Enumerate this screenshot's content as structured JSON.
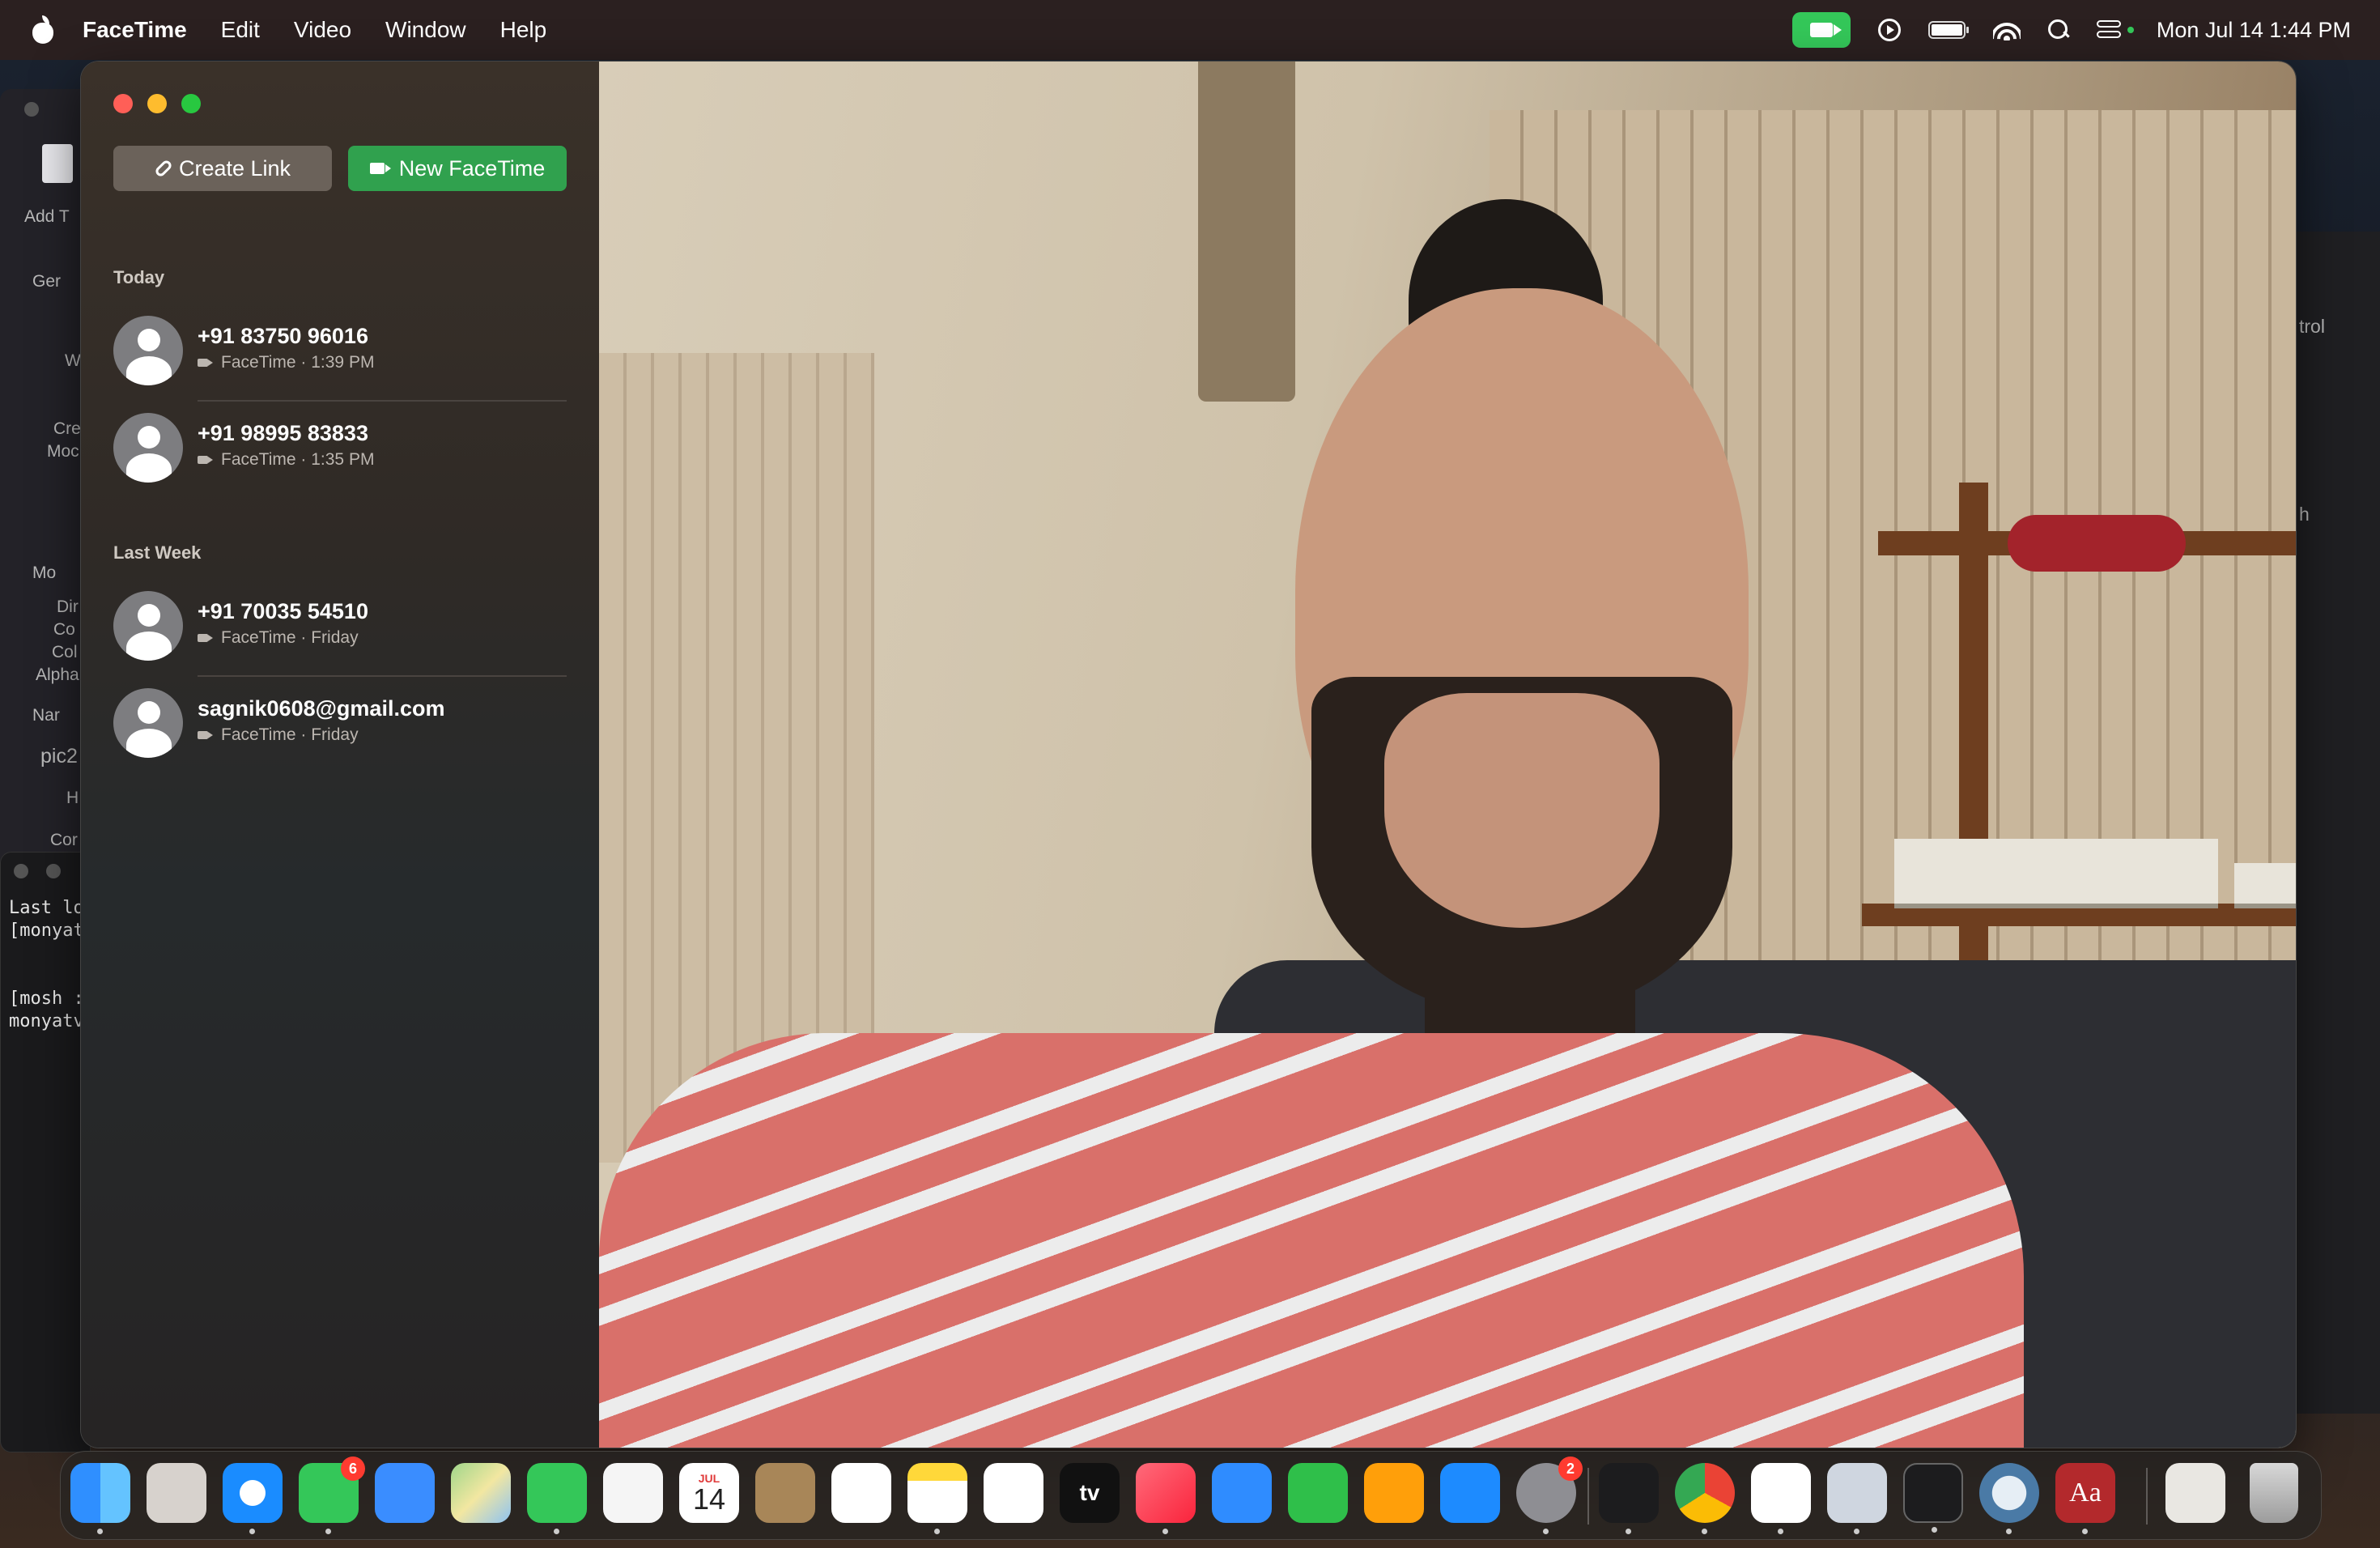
{
  "menubar": {
    "app_name": "FaceTime",
    "items": [
      "Edit",
      "Video",
      "Window",
      "Help"
    ],
    "clock": "Mon Jul 14  1:44 PM",
    "icons": [
      "facetime-camera-indicator-icon",
      "now-playing-icon",
      "battery-icon",
      "wifi-icon",
      "spotlight-search-icon",
      "control-center-icon"
    ],
    "accent": "#34c759"
  },
  "background_left": {
    "texts": [
      "Add T",
      "Ger",
      "W",
      "Cre",
      "Moc",
      "Mo",
      "Dir",
      "Co",
      "Col",
      "Alpha",
      "Nar",
      "pic2",
      "H",
      "Cor"
    ]
  },
  "terminal": {
    "lines": [
      "Last lo",
      "[monyatv",
      "[mosh :",
      "monyatv"
    ]
  },
  "background_right": {
    "texts": [
      "trol",
      "h"
    ]
  },
  "facetime": {
    "create_link_label": "Create Link",
    "new_facetime_label": "New FaceTime",
    "sections": [
      {
        "title": "Today",
        "calls": [
          {
            "name": "+91 83750 96016",
            "detail": "FaceTime · 1:39 PM"
          },
          {
            "name": "+91 98995 83833",
            "detail": "FaceTime · 1:35 PM"
          }
        ]
      },
      {
        "title": "Last Week",
        "calls": [
          {
            "name": "+91 70035 54510",
            "detail": "FaceTime · Friday"
          },
          {
            "name": "sagnik0608@gmail.com",
            "detail": "FaceTime · Friday"
          }
        ]
      }
    ]
  },
  "dock": {
    "calendar_month": "JUL",
    "calendar_day": "14",
    "messages_badge": "6",
    "settings_badge": "2",
    "appletv_label": "tv",
    "dictionary_label": "Aa",
    "apps": [
      "Finder",
      "Launchpad",
      "Safari",
      "Messages",
      "Mail",
      "Maps",
      "FaceTime",
      "Photos",
      "Calendar",
      "Contacts",
      "Reminders",
      "Notes",
      "Freeform",
      "TV",
      "Music",
      "Keynote",
      "Numbers",
      "Pages",
      "App Store",
      "System Settings",
      "Activity Monitor",
      "Chrome",
      "VS Code",
      "Preview",
      "Terminal",
      "QuickTime",
      "Dictionary",
      "Printer",
      "Trash"
    ]
  }
}
